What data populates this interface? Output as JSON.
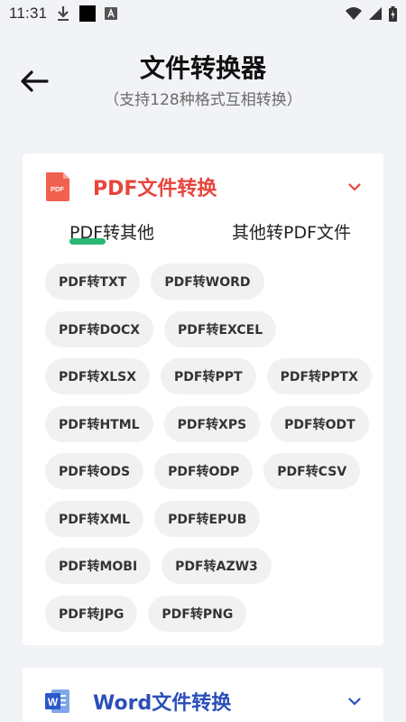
{
  "status_bar": {
    "time": "11:31",
    "icons_left": [
      "download-icon",
      "black-square-icon",
      "a-icon"
    ],
    "icons_right": [
      "wifi-icon",
      "signal-icon",
      "battery-icon"
    ]
  },
  "header": {
    "back_icon": "arrow-left-icon",
    "title": "文件转换器",
    "subtitle": "（支持128种格式互相转换）"
  },
  "pdf_section": {
    "icon": "pdf-file-icon",
    "icon_text": "PDF",
    "title": "PDF文件转换",
    "title_color": "#e8453c",
    "expanded": true,
    "tabs": [
      {
        "label": "PDF转其他",
        "active": true
      },
      {
        "label": "其他转PDF文件",
        "active": false
      }
    ],
    "chips": [
      [
        "PDF转TXT",
        "PDF转WORD"
      ],
      [
        "PDF转DOCX",
        "PDF转EXCEL"
      ],
      [
        "PDF转XLSX",
        "PDF转PPT",
        "PDF转PPTX"
      ],
      [
        "PDF转HTML",
        "PDF转XPS",
        "PDF转ODT"
      ],
      [
        "PDF转ODS",
        "PDF转ODP",
        "PDF转CSV"
      ],
      [
        "PDF转XML",
        "PDF转EPUB"
      ],
      [
        "PDF转MOBI",
        "PDF转AZW3"
      ],
      [
        "PDF转JPG",
        "PDF转PNG"
      ]
    ]
  },
  "word_section": {
    "icon": "word-file-icon",
    "icon_text": "W",
    "title": "Word文件转换",
    "title_color": "#2b4fb8",
    "expanded": false
  },
  "colors": {
    "background": "#f1f3f6",
    "card": "#ffffff",
    "chip": "#f1f1f1",
    "tab_underline": "#2bb673"
  }
}
